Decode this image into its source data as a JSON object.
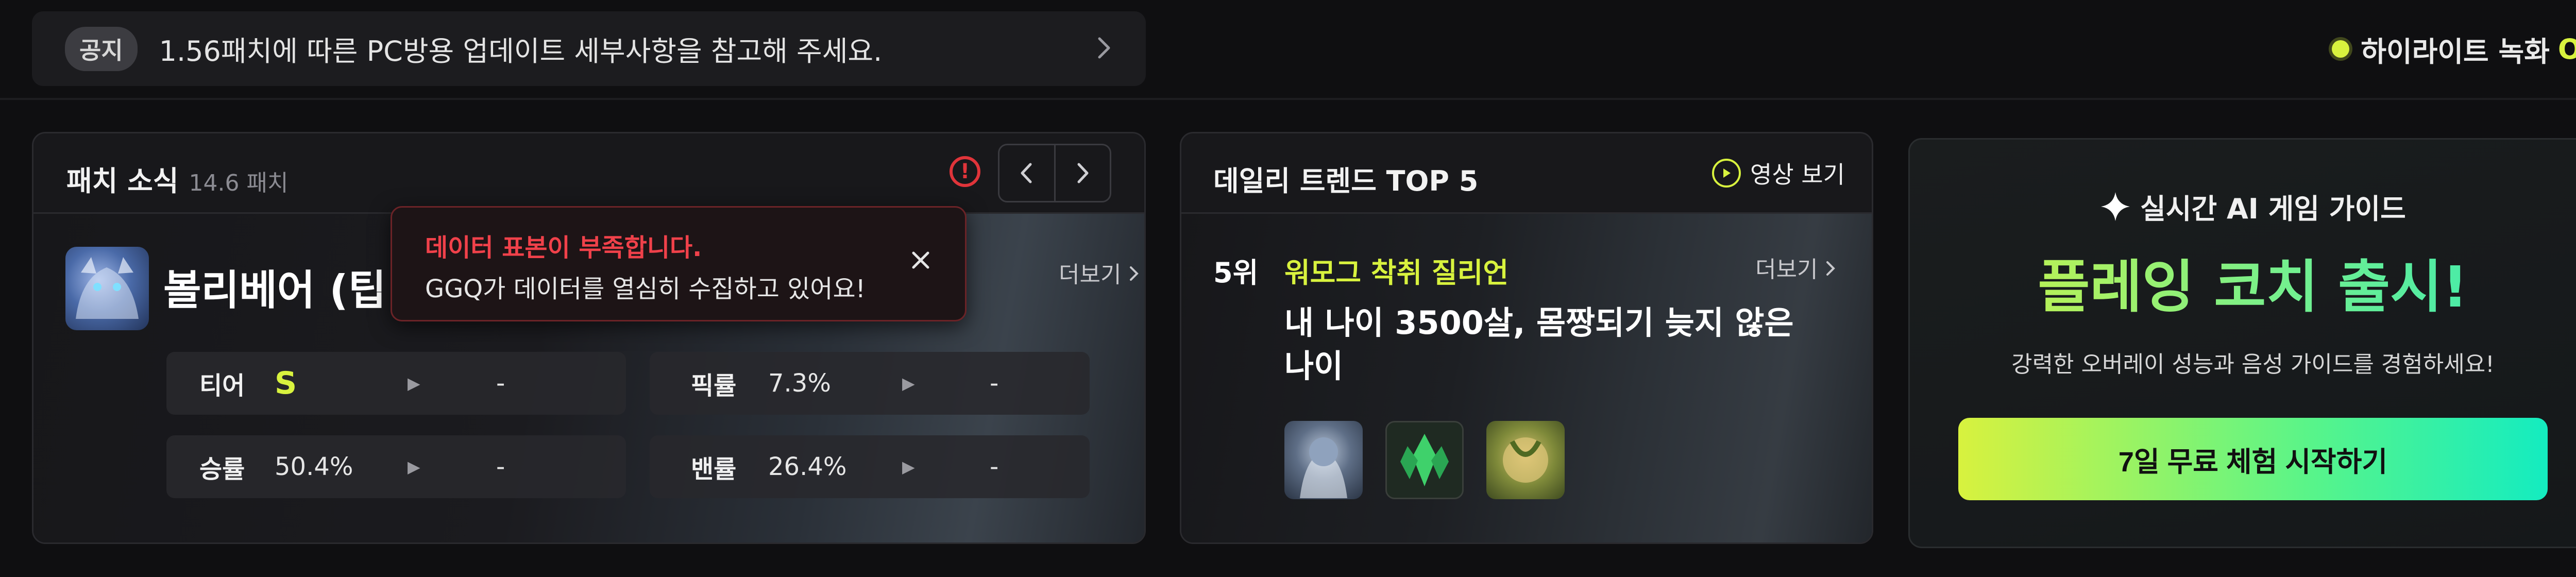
{
  "notice": {
    "badge": "공지",
    "text": "1.56패치에 따른 PC방용 업데이트 세부사항을 참고해 주세요."
  },
  "highlight": {
    "label": "하이라이트 녹화",
    "status": "ON",
    "status_color": "#d8f23e"
  },
  "patch": {
    "title": "패치 소식",
    "version": "14.6 패치",
    "champion": "볼리베어 (팁",
    "more": "더보기",
    "stats": {
      "tier_label": "티어",
      "tier_value": "S",
      "pick_label": "픽률",
      "pick_value": "7.3%",
      "win_label": "승률",
      "win_value": "50.4%",
      "ban_label": "밴률",
      "ban_value": "26.4%",
      "arrow": "▶",
      "dash": "-"
    },
    "icons": [
      "alert-icon",
      "chevron-left-icon",
      "chevron-right-icon"
    ]
  },
  "toast": {
    "title": "데이터 표본이 부족합니다.",
    "message": "GGQ가 데이터를 열심히 수집하고 있어요!",
    "title_color": "#f0414a"
  },
  "trend": {
    "title": "데일리 트렌드 TOP 5",
    "video": "영상 보기",
    "rank": "5위",
    "name": "워모그 착취 질리언",
    "more": "더보기",
    "headline": "내 나이 3500살, 몸짱되기 늦지 않은 나이"
  },
  "promo": {
    "subtitle": "실시간 AI 게임 가이드",
    "title": "플레잉 코치 출시!",
    "description": "강력한 오버레이 성능과 음성 가이드를 경험하세요!",
    "cta": "7일 무료 체험 시작하기",
    "accent_start": "#d8f23e",
    "accent_end": "#14ecc0"
  }
}
